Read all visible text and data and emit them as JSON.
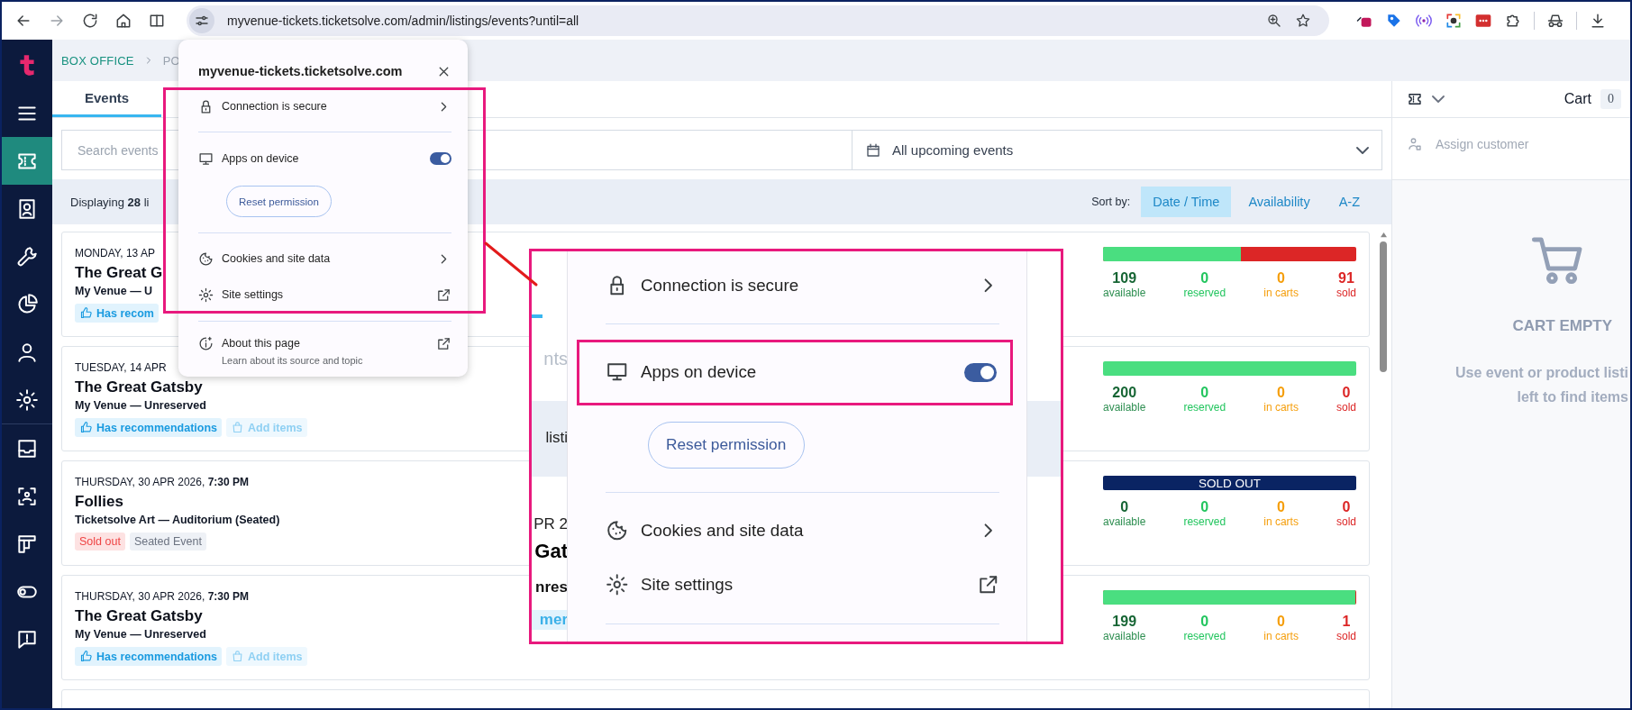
{
  "browser": {
    "url": "myvenue-tickets.ticketsolve.com/admin/listings/events?until=all"
  },
  "sidebar": {
    "items": [
      {
        "kind": "menu",
        "selected": false
      },
      {
        "kind": "ticket",
        "selected": true
      },
      {
        "kind": "contact",
        "selected": false
      },
      {
        "kind": "wrench",
        "selected": false
      },
      {
        "kind": "chart",
        "selected": false
      },
      {
        "kind": "user",
        "selected": false
      },
      {
        "kind": "gear",
        "selected": false
      }
    ],
    "lower_items": [
      {
        "kind": "inbox",
        "selected": false
      },
      {
        "kind": "scan",
        "selected": false
      },
      {
        "kind": "board",
        "selected": false
      },
      {
        "kind": "toggle",
        "selected": false
      },
      {
        "kind": "feedback",
        "selected": false
      }
    ]
  },
  "breadcrumb": [
    "BOX OFFICE",
    "PO"
  ],
  "tabs": [
    {
      "label": "Events",
      "selected": true
    }
  ],
  "search": {
    "placeholder": "Search events"
  },
  "date_filter": {
    "value": "All upcoming events"
  },
  "listing_summary": "Displaying **28** li",
  "sort": {
    "label": "Sort by:",
    "options": [
      {
        "label": "Date / Time",
        "selected": true
      },
      {
        "label": "Availability",
        "selected": false
      },
      {
        "label": "A-Z",
        "selected": false
      }
    ]
  },
  "events": [
    {
      "date": "MONDAY, 13 AP",
      "title": "The Great G",
      "venue": "My Venue — U",
      "tags": [
        {
          "kind": "recommend",
          "label": "Has recom"
        }
      ],
      "bar": {
        "kind": "split",
        "level": 0.545
      },
      "stats": [
        {
          "kind": "available",
          "value": "109",
          "label": "available"
        },
        {
          "kind": "reserved",
          "value": "0",
          "label": "reserved"
        },
        {
          "kind": "carts",
          "value": "0",
          "label": "in carts"
        },
        {
          "kind": "sold",
          "value": "91",
          "label": "sold"
        }
      ]
    },
    {
      "date": "TUESDAY, 14 APR",
      "title": "The Great Gatsby",
      "venue": "My Venue — Unreserved",
      "tags": [
        {
          "kind": "recommend",
          "label": "Has recommendations"
        },
        {
          "kind": "add",
          "label": "Add items"
        }
      ],
      "bar": {
        "kind": "split",
        "level": 1
      },
      "stats": [
        {
          "kind": "available",
          "value": "200",
          "label": "available"
        },
        {
          "kind": "reserved",
          "value": "0",
          "label": "reserved"
        },
        {
          "kind": "carts",
          "value": "0",
          "label": "in carts"
        },
        {
          "kind": "sold",
          "value": "0",
          "label": "sold"
        }
      ]
    },
    {
      "date": "THURSDAY, 30 APR 2026, **7:30 PM**",
      "title": "Follies",
      "venue": "Ticketsolve Art — Auditorium (Seated)",
      "tags": [
        {
          "kind": "soldout",
          "label": "Sold out"
        },
        {
          "kind": "seated",
          "label": "Seated Event"
        }
      ],
      "bar": {
        "kind": "banner",
        "label": "SOLD OUT"
      },
      "stats": [
        {
          "kind": "available",
          "value": "0",
          "label": "available"
        },
        {
          "kind": "reserved",
          "value": "0",
          "label": "reserved"
        },
        {
          "kind": "carts",
          "value": "0",
          "label": "in carts"
        },
        {
          "kind": "sold",
          "value": "0",
          "label": "sold"
        }
      ]
    },
    {
      "date": "THURSDAY, 30 APR 2026, **7:30 PM**",
      "title": "The Great Gatsby",
      "venue": "My Venue — Unreserved",
      "tags": [
        {
          "kind": "recommend",
          "label": "Has recommendations"
        },
        {
          "kind": "add",
          "label": "Add items"
        }
      ],
      "bar": {
        "kind": "split",
        "level": 0.995
      },
      "stats": [
        {
          "kind": "available",
          "value": "199",
          "label": "available"
        },
        {
          "kind": "reserved",
          "value": "0",
          "label": "reserved"
        },
        {
          "kind": "carts",
          "value": "0",
          "label": "in carts"
        },
        {
          "kind": "sold",
          "value": "1",
          "label": "sold"
        }
      ]
    }
  ],
  "cart": {
    "title": "Cart",
    "count": "0",
    "assign": "Assign customer",
    "empty_title": "CART EMPTY",
    "empty_hint": [
      "Use event or product listi",
      "left to find items"
    ]
  },
  "popup": {
    "title": "myvenue-tickets.ticketsolve.com",
    "rows": [
      {
        "kind": "secure",
        "label": "Connection is secure"
      },
      {
        "kind": "permission",
        "label": "Apps on device",
        "on": true,
        "button": "Reset permission"
      },
      {
        "kind": "cookies",
        "label": "Cookies and site data"
      },
      {
        "kind": "settings",
        "label": "Site settings"
      },
      {
        "kind": "about",
        "label": "About this page",
        "subtitle": "Learn about its source and topic"
      }
    ]
  },
  "zoom_inset": {
    "fragments": [
      "nts",
      "listi",
      "PR 2",
      "Gat",
      "nres",
      "mer"
    ],
    "rows": [
      {
        "kind": "secure",
        "label": "Connection is secure"
      },
      {
        "kind": "permission",
        "label": "Apps on device",
        "on": true,
        "button": "Reset permission"
      },
      {
        "kind": "cookies",
        "label": "Cookies and site data"
      },
      {
        "kind": "settings",
        "label": "Site settings"
      }
    ]
  }
}
